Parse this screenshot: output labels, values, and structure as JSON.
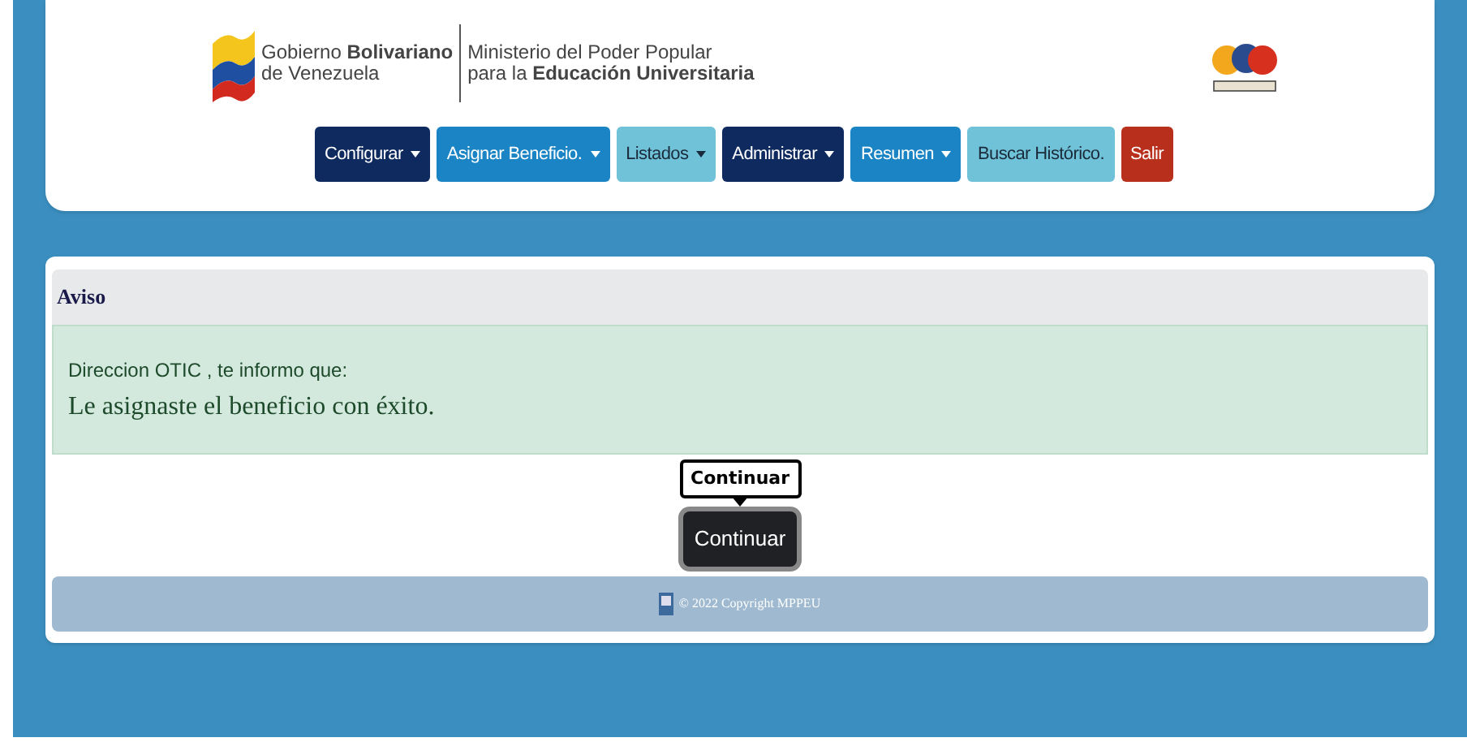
{
  "header": {
    "gov_name": [
      "Gobierno **Bolivariano**",
      "de Venezuela"
    ],
    "ministry": [
      "Ministerio del Poder Popular",
      "para la **Educación Universitaria**"
    ]
  },
  "nav": [
    {
      "label": "Configurar",
      "dropdown": true,
      "color": "#0f2a5e"
    },
    {
      "label": "Asignar Beneficio.",
      "dropdown": true,
      "color": "#1b84c4"
    },
    {
      "label": "Listados",
      "dropdown": true,
      "color": "#6fc2d8"
    },
    {
      "label": "Administrar",
      "dropdown": true,
      "color": "#0f2a5e"
    },
    {
      "label": "Resumen",
      "dropdown": true,
      "color": "#1b84c4"
    },
    {
      "label": "Buscar Histórico.",
      "dropdown": false,
      "color": "#6fc2d8"
    },
    {
      "label": "Salir",
      "dropdown": false,
      "color": "#b8301c"
    }
  ],
  "notice": {
    "title": "Aviso",
    "intro": "Direccion OTIC , te informo que:",
    "message": "Le asignaste el beneficio con éxito."
  },
  "tooltip": "Continuar",
  "button": "Continuar",
  "footer": "© 2022 Copyright MPPEU"
}
